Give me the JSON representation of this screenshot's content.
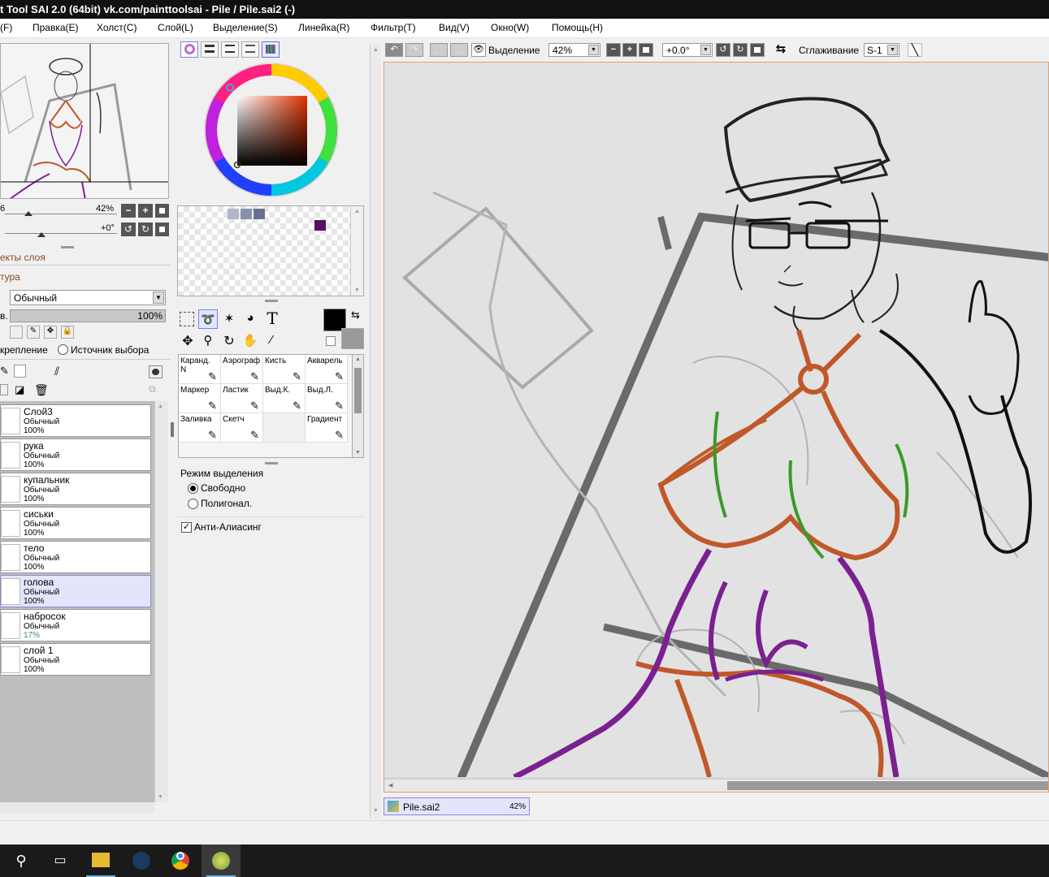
{
  "window": {
    "title": "t Tool SAI 2.0 (64bit) vk.com/painttoolsai - Pile / Pile.sai2 (-)"
  },
  "menu": [
    "(F)",
    "Правка(E)",
    "Холст(C)",
    "Слой(L)",
    "Выделение(S)",
    "Линейка(R)",
    "Фильтр(T)",
    "Вид(V)",
    "Окно(W)",
    "Помощь(H)"
  ],
  "navigator": {
    "zoom_left": "6",
    "zoom_value": "42%",
    "angle_value": "+0°"
  },
  "layer_panel": {
    "effects_label": "екты слоя",
    "texture_label": "тура",
    "blend_mode": "Обычный",
    "opacity_prefix": "в.",
    "opacity_value": "100%",
    "clip_label": "крепление",
    "source_label": "Источник выбора",
    "layers": [
      {
        "name": "Слой3",
        "mode": "Обычный",
        "opacity": "100%",
        "selected": false
      },
      {
        "name": "рука",
        "mode": "Обычный",
        "opacity": "100%",
        "selected": false
      },
      {
        "name": "купальник",
        "mode": "Обычный",
        "opacity": "100%",
        "selected": false
      },
      {
        "name": "сиськи",
        "mode": "Обычный",
        "opacity": "100%",
        "selected": false
      },
      {
        "name": "тело",
        "mode": "Обычный",
        "opacity": "100%",
        "selected": false
      },
      {
        "name": "голова",
        "mode": "Обычный",
        "opacity": "100%",
        "selected": true
      },
      {
        "name": "набросок",
        "mode": "Обычный",
        "opacity": "17%",
        "selected": false
      },
      {
        "name": "слой 1",
        "mode": "Обычный",
        "opacity": "100%",
        "selected": false
      }
    ]
  },
  "colors": {
    "foreground": "#000000",
    "background": "#9a9a9a",
    "swatch_purple": "#5a1060",
    "hue_marker": "#4aa6d8"
  },
  "brushes": [
    {
      "label": "Каранд.",
      "sub": "N"
    },
    {
      "label": "Аэрограф",
      "sub": ""
    },
    {
      "label": "Кисть",
      "sub": ""
    },
    {
      "label": "Акварель",
      "sub": ""
    },
    {
      "label": "Маркер",
      "sub": ""
    },
    {
      "label": "Ластик",
      "sub": ""
    },
    {
      "label": "Выд.К.",
      "sub": ""
    },
    {
      "label": "Выд.Л.",
      "sub": ""
    },
    {
      "label": "Заливка",
      "sub": ""
    },
    {
      "label": "Скетч",
      "sub": ""
    },
    {
      "label": "",
      "sub": ""
    },
    {
      "label": "Градиент",
      "sub": ""
    }
  ],
  "selection_options": {
    "title": "Режим выделения",
    "free": "Свободно",
    "polygon": "Полигонал.",
    "antialias": "Анти-Алиасинг"
  },
  "toolbar": {
    "selection_label": "Выделение",
    "zoom": "42%",
    "angle": "+0.0°",
    "smoothing_label": "Сглаживание",
    "smoothing_value": "S-1"
  },
  "document_tab": {
    "name": "Pile.sai2",
    "zoom": "42%"
  }
}
